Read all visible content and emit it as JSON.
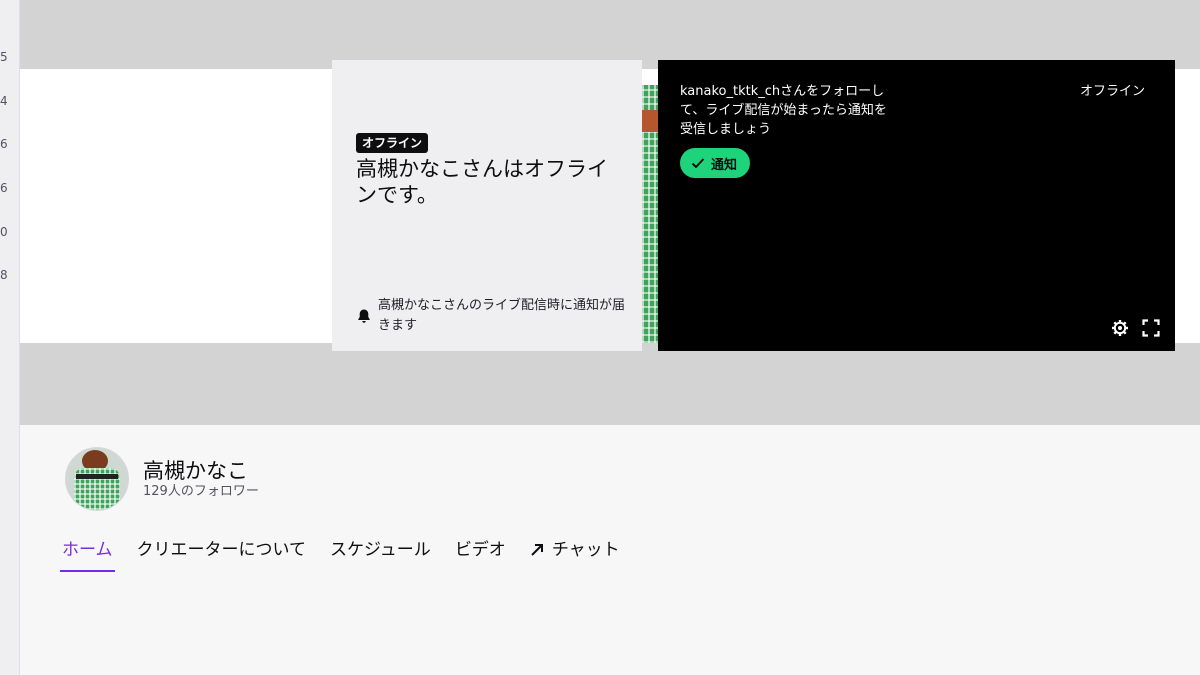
{
  "sidebar": {
    "partial_digits": [
      "5",
      "4",
      "6",
      "6",
      "0",
      "8"
    ]
  },
  "offline_card": {
    "badge": "オフライン",
    "title": "高槻かなこさんはオフラインです。",
    "notify_text": "高槻かなこさんのライブ配信時に通知が届きます"
  },
  "player": {
    "follow_message": "kanako_tktk_chさんをフォローして、ライブ配信が始まったら通知を受信しましょう",
    "status": "オフライン",
    "notify_button": "通知"
  },
  "channel": {
    "name": "高槻かなこ",
    "followers": "129人のフォロワー"
  },
  "tabs": [
    {
      "label": "ホーム",
      "active": true
    },
    {
      "label": "クリエーターについて"
    },
    {
      "label": "スケジュール"
    },
    {
      "label": "ビデオ"
    },
    {
      "label": "チャット"
    }
  ],
  "colors": {
    "accent": "#772ce8",
    "notify_green": "#1ed47a"
  }
}
